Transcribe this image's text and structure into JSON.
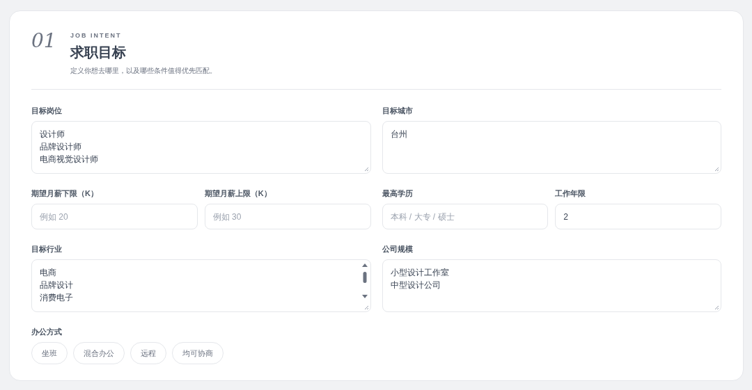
{
  "section": {
    "number": "01",
    "eyebrow": "JOB INTENT",
    "title": "求职目标",
    "description": "定义你想去哪里，以及哪些条件值得优先匹配。"
  },
  "fields": [
    {
      "kind": "textarea",
      "label": "目标岗位",
      "lines": [
        "设计师",
        "品牌设计师",
        "电商视觉设计师"
      ]
    },
    {
      "kind": "textarea",
      "label": "目标城市",
      "lines": [
        "台州"
      ]
    },
    {
      "kind": "input",
      "label": "期望月薪下限（K）",
      "placeholder": "例如 20"
    },
    {
      "kind": "input",
      "label": "期望月薪上限（K）",
      "placeholder": "例如 30"
    },
    {
      "kind": "input",
      "label": "最高学历",
      "placeholder": "本科 / 大专 / 硕士"
    },
    {
      "kind": "input",
      "label": "工作年限",
      "value": "2"
    },
    {
      "kind": "scrolltextarea",
      "label": "目标行业",
      "lines": [
        "电商",
        "品牌设计",
        "消费电子"
      ]
    },
    {
      "kind": "textarea",
      "label": "公司规模",
      "lines": [
        "小型设计工作室",
        "中型设计公司"
      ]
    }
  ],
  "work_mode": {
    "label": "办公方式",
    "options": [
      {
        "label": "坐班",
        "selected": false
      },
      {
        "label": "混合办公",
        "selected": false
      },
      {
        "label": "远程",
        "selected": false
      },
      {
        "label": "均可协商",
        "selected": false
      }
    ]
  }
}
